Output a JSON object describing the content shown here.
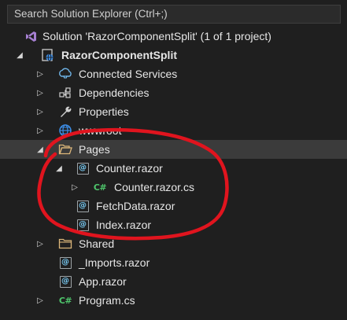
{
  "search": {
    "placeholder": "Search Solution Explorer (Ctrl+;)"
  },
  "tree": {
    "items": [
      {
        "label": "Solution 'RazorComponentSplit' (1 of 1 project)",
        "icon": "solution-icon",
        "expanded": null,
        "bold": false
      },
      {
        "label": "RazorComponentSplit",
        "icon": "web-project-icon",
        "expanded": true,
        "bold": true
      },
      {
        "label": "Connected Services",
        "icon": "connected-services-icon",
        "expanded": false,
        "bold": false
      },
      {
        "label": "Dependencies",
        "icon": "dependencies-icon",
        "expanded": false,
        "bold": false
      },
      {
        "label": "Properties",
        "icon": "properties-wrench-icon",
        "expanded": false,
        "bold": false
      },
      {
        "label": "wwwroot",
        "icon": "globe-icon",
        "expanded": false,
        "bold": false
      },
      {
        "label": "Pages",
        "icon": "open-folder-icon",
        "expanded": true,
        "bold": false,
        "selected": true
      },
      {
        "label": "Counter.razor",
        "icon": "razor-file-icon",
        "expanded": true,
        "bold": false
      },
      {
        "label": "Counter.razor.cs",
        "icon": "csharp-file-icon",
        "expanded": false,
        "bold": false
      },
      {
        "label": "FetchData.razor",
        "icon": "razor-file-icon",
        "expanded": null,
        "bold": false
      },
      {
        "label": "Index.razor",
        "icon": "razor-file-icon",
        "expanded": null,
        "bold": false
      },
      {
        "label": "Shared",
        "icon": "folder-icon",
        "expanded": false,
        "bold": false
      },
      {
        "label": "_Imports.razor",
        "icon": "razor-file-icon",
        "expanded": null,
        "bold": false
      },
      {
        "label": "App.razor",
        "icon": "razor-file-icon",
        "expanded": null,
        "bold": false
      },
      {
        "label": "Program.cs",
        "icon": "csharp-file-icon",
        "expanded": false,
        "bold": false
      }
    ]
  },
  "glyphs": {
    "razor": "@",
    "csharp": "C#"
  },
  "colors": {
    "background": "#1f1f1f",
    "selection": "#3b3b3b",
    "annotation": "#e0141e",
    "folder": "#dcb67a",
    "razor_at": "#76c7f0",
    "csharp": "#4ec56b",
    "solution": "#a57fd1",
    "project": "#3c8ee8"
  }
}
